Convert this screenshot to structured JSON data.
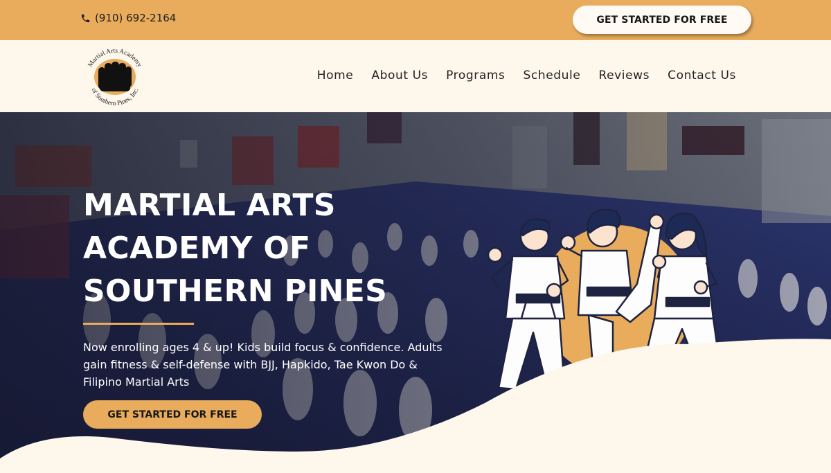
{
  "topbar": {
    "phone": "(910) 692-2164",
    "cta_label": "GET STARTED FOR FREE"
  },
  "header": {
    "logo_text_top": "Martial Arts Academy",
    "logo_text_bottom": "of Southern Pines, Inc.",
    "nav": [
      {
        "label": "Home"
      },
      {
        "label": "About Us"
      },
      {
        "label": "Programs"
      },
      {
        "label": "Schedule"
      },
      {
        "label": "Reviews"
      },
      {
        "label": "Contact Us"
      }
    ]
  },
  "hero": {
    "title_lines": [
      "MARTIAL ARTS",
      "ACADEMY OF",
      "SOUTHERN PINES"
    ],
    "description": "Now enrolling ages 4 & up! Kids build focus & confidence. Adults gain fitness & self-defense with BJJ, Hapkido, Tae Kwon Do & Filipino Martial Arts",
    "cta_label": "GET STARTED FOR FREE"
  },
  "colors": {
    "accent": "#e8ac5c",
    "cream": "#fdf7ec",
    "dark": "#161616"
  }
}
